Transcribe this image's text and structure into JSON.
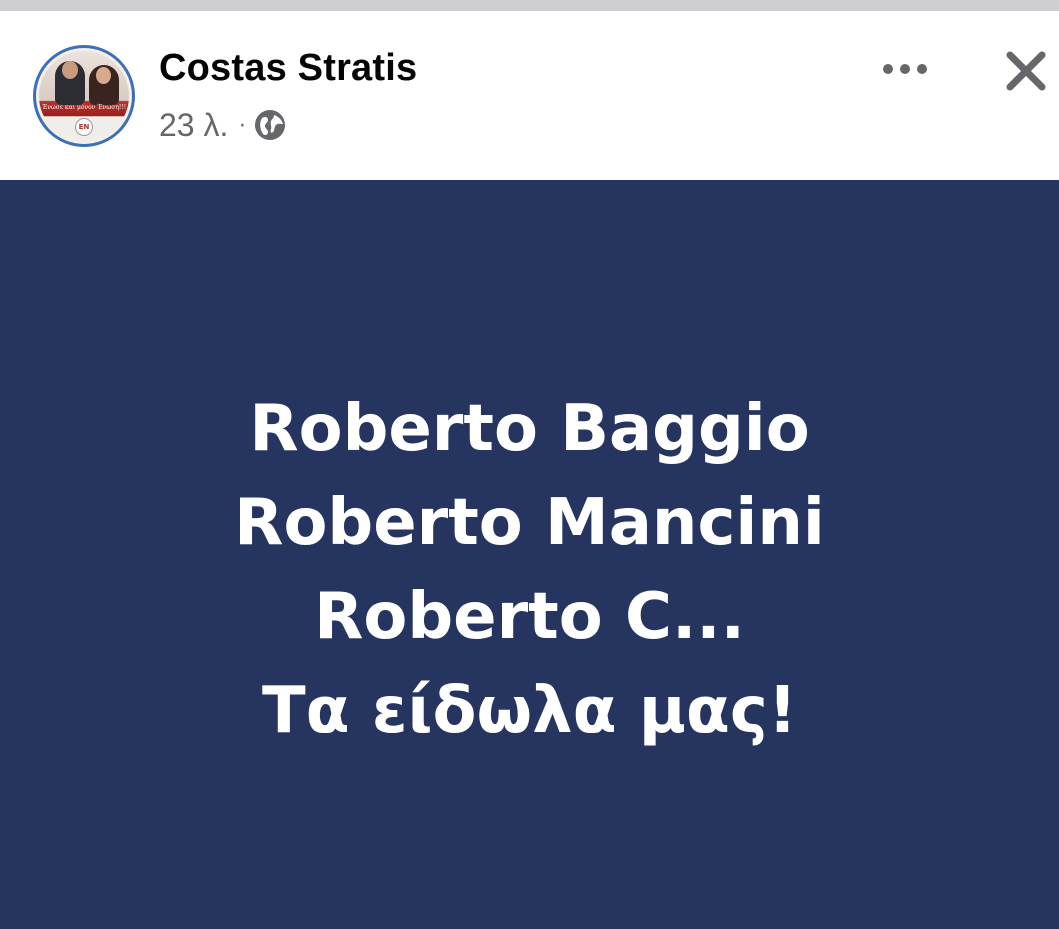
{
  "post": {
    "author": "Costas Stratis",
    "timestamp": "23 λ.",
    "separator": "·",
    "visibility_icon": "globe-icon",
    "avatar": {
      "ribbon_text": "Ένωσε και μόνον Ένωση!!!",
      "logo_text": "ΕΝ"
    },
    "actions": {
      "more_icon": "more-horizontal-icon",
      "close_icon": "close-icon"
    },
    "background_color": "#253560",
    "text_color": "#ffffff",
    "lines": [
      "Roberto Baggio",
      "Roberto Mancini",
      "Roberto C...",
      "Τα είδωλα μας!"
    ]
  }
}
